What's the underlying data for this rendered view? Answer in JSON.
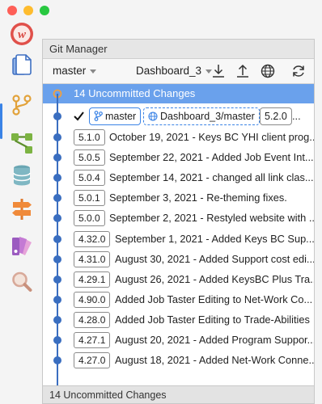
{
  "app": {
    "panel_title": "Git Manager",
    "footer_text": "14 Uncommitted Changes"
  },
  "colors": {
    "accent": "#3a83e6",
    "selection": "#6aa1ec",
    "graph": "#3a6ec0",
    "traffic_red": "#fe5f57",
    "traffic_yellow": "#febc2e",
    "traffic_green": "#28c840"
  },
  "sidebar": {
    "items": [
      {
        "name": "app-logo-icon"
      },
      {
        "name": "documents-icon"
      },
      {
        "name": "git-icon"
      },
      {
        "name": "workflow-icon"
      },
      {
        "name": "database-icon"
      },
      {
        "name": "signpost-icon"
      },
      {
        "name": "palette-icon"
      },
      {
        "name": "search-icon"
      }
    ]
  },
  "toolbar": {
    "branch": "master",
    "repo": "Dashboard_3"
  },
  "uncommitted": {
    "label": "14 Uncommitted Changes"
  },
  "head": {
    "branch_badge": "master",
    "remote_badge": "Dashboard_3/master",
    "version": "5.2.0",
    "ellipsis": "..."
  },
  "commits": [
    {
      "tag": "5.1.0",
      "message": "October 19, 2021 - Keys BC YHI client prog..."
    },
    {
      "tag": "5.0.5",
      "message": "September 22, 2021 - Added Job Event Int..."
    },
    {
      "tag": "5.0.4",
      "message": "September 14, 2021 - changed all link clas..."
    },
    {
      "tag": "5.0.1",
      "message": "September 3, 2021 - Re-theming fixes."
    },
    {
      "tag": "5.0.0",
      "message": "September 2, 2021 - Restyled website with ..."
    },
    {
      "tag": "4.32.0",
      "message": "September 1, 2021 - Added Keys BC Sup..."
    },
    {
      "tag": "4.31.0",
      "message": "August 30, 2021 - Added Support cost edi..."
    },
    {
      "tag": "4.29.1",
      "message": "August 26, 2021 - Added KeysBC Plus Tra..."
    },
    {
      "tag": "4.90.0",
      "message": "Added Job Taster Editing to Net-Work Co..."
    },
    {
      "tag": "4.28.0",
      "message": "Added Job Taster Editing to Trade-Abilities"
    },
    {
      "tag": "4.27.1",
      "message": "August 20, 2021 - Added Program Suppor..."
    },
    {
      "tag": "4.27.0",
      "message": "August 18, 2021 - Added Net-Work Conne..."
    }
  ]
}
